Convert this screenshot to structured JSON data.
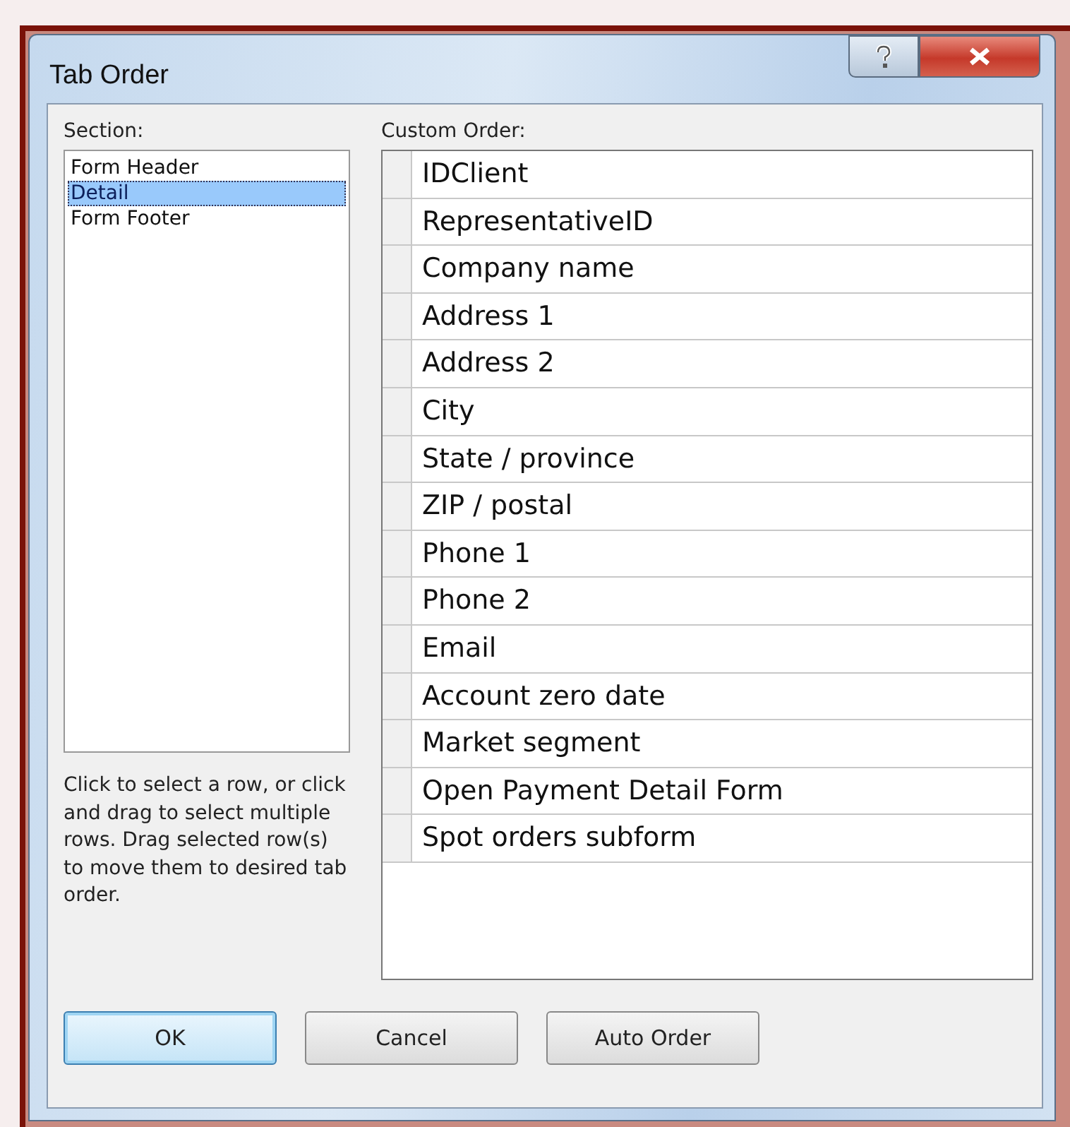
{
  "window": {
    "title": "Tab Order"
  },
  "section": {
    "label": "Section:",
    "items": [
      {
        "label": "Form Header",
        "selected": false
      },
      {
        "label": "Detail",
        "selected": true
      },
      {
        "label": "Form Footer",
        "selected": false
      }
    ]
  },
  "custom_order": {
    "label": "Custom Order:",
    "rows": [
      {
        "label": "IDClient"
      },
      {
        "label": "RepresentativeID"
      },
      {
        "label": "Company name"
      },
      {
        "label": "Address 1"
      },
      {
        "label": "Address 2"
      },
      {
        "label": "City"
      },
      {
        "label": "State / province"
      },
      {
        "label": "ZIP / postal"
      },
      {
        "label": "Phone 1"
      },
      {
        "label": "Phone 2"
      },
      {
        "label": "Email"
      },
      {
        "label": "Account zero date"
      },
      {
        "label": "Market segment"
      },
      {
        "label": "Open Payment Detail Form"
      },
      {
        "label": "Spot orders subform"
      }
    ]
  },
  "help_text": "Click to select a row, or click and drag to select multiple rows.  Drag selected row(s) to move them to desired tab order.",
  "buttons": [
    {
      "label": "OK",
      "default": true
    },
    {
      "label": "Cancel",
      "default": false
    },
    {
      "label": "Auto Order",
      "default": false
    }
  ]
}
